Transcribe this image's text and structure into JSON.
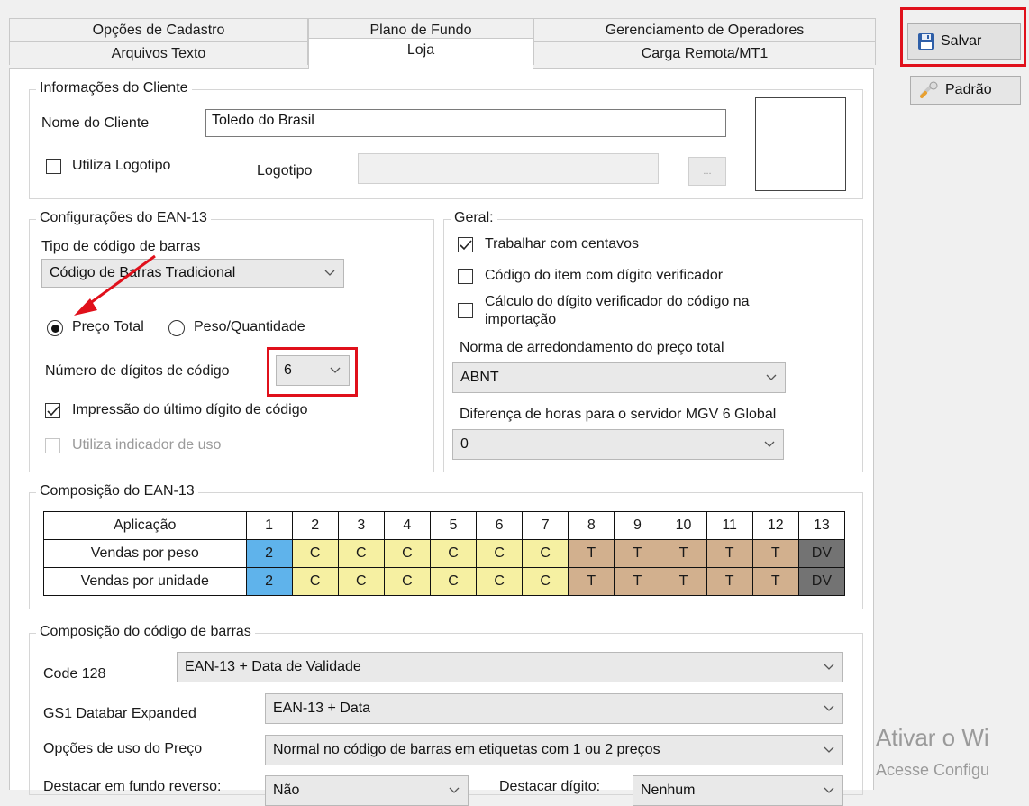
{
  "tabs": {
    "row1": [
      "Opções de Cadastro",
      "Plano de Fundo",
      "Gerenciamento de Operadores"
    ],
    "row2": [
      "Arquivos Texto",
      "Loja",
      "Carga Remota/MT1"
    ]
  },
  "buttons": {
    "save": "Salvar",
    "default": "Padrão"
  },
  "client_info": {
    "legend": "Informações do Cliente",
    "name_label": "Nome do Cliente",
    "name_value": "Toledo do Brasil",
    "use_logo_label": "Utiliza Logotipo",
    "logo_label": "Logotipo",
    "browse_label": "..."
  },
  "ean_config": {
    "legend": "Configurações do EAN-13",
    "barcode_type_label": "Tipo de código de barras",
    "barcode_type_value": "Código de Barras Tradicional",
    "radio_total_price": "Preço Total",
    "radio_weight_qty": "Peso/Quantidade",
    "digits_label": "Número de dígitos de código",
    "digits_value": "6",
    "print_last_digit_label": "Impressão do último dígito de código",
    "use_indicator_label": "Utiliza indicador de uso"
  },
  "general": {
    "legend": "Geral:",
    "cents_label": "Trabalhar com centavos",
    "check_digit_label": "Código do item com dígito verificador",
    "calc_digit_label_1": "Cálculo do dígito verificador do código na",
    "calc_digit_label_2": "importação",
    "rounding_label": "Norma de arredondamento do preço total",
    "rounding_value": "ABNT",
    "hours_diff_label": "Diferença de horas para o servidor MGV 6 Global",
    "hours_diff_value": "0"
  },
  "composition": {
    "legend": "Composição do EAN-13",
    "header": [
      "Aplicação",
      "1",
      "2",
      "3",
      "4",
      "5",
      "6",
      "7",
      "8",
      "9",
      "10",
      "11",
      "12",
      "13"
    ],
    "rows": [
      [
        "Vendas por peso",
        "2",
        "C",
        "C",
        "C",
        "C",
        "C",
        "C",
        "T",
        "T",
        "T",
        "T",
        "T",
        "DV"
      ],
      [
        "Vendas por unidade",
        "2",
        "C",
        "C",
        "C",
        "C",
        "C",
        "C",
        "T",
        "T",
        "T",
        "T",
        "T",
        "DV"
      ]
    ],
    "colors": {
      "prefix": "#5fb3eb",
      "code": "#f6f0a2",
      "price": "#d2b08e",
      "check": "#737373"
    }
  },
  "barcode_composition": {
    "legend": "Composição do código de barras",
    "code128_label": "Code 128",
    "code128_value": "EAN-13 + Data de Validade",
    "gs1_label": "GS1 Databar Expanded",
    "gs1_value": "EAN-13 + Data",
    "price_options_label": "Opções de uso do Preço",
    "price_options_value": "Normal no código de barras em etiquetas com 1 ou 2 preços",
    "highlight_label": "Destacar em fundo reverso:",
    "highlight_value": "Não",
    "highlight_digit_label": "Destacar dígito:",
    "highlight_digit_value": "Nenhum"
  },
  "watermark": {
    "line1": "Ativar o Wi",
    "line2": "Acesse Configu"
  },
  "annotation_color": "#e0101b"
}
